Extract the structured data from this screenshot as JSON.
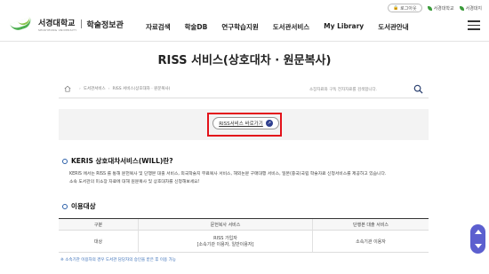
{
  "utility": {
    "login": "로그아웃",
    "link1": "서경대학교",
    "link2": "서경대지"
  },
  "logo": {
    "name": "서경대학교",
    "sub": "SEOKYEONG UNIVERSITY",
    "library": "학술정보관"
  },
  "gnb": [
    "자료검색",
    "학술DB",
    "연구학습지원",
    "도서관서비스",
    "My Library",
    "도서관안내"
  ],
  "page_title": "RISS 서비스(상호대차 · 원문복사)",
  "breadcrumb": [
    "도서관서비스",
    "RISS 서비스(상호대차 · 원문복사)"
  ],
  "search": {
    "placeholder": "소장자료와 구독 전자자료를 검색합니다."
  },
  "riss_button": "RISS서비스 바로가기",
  "keris": {
    "title": "KERIS 상호대차서비스(WILL)란?",
    "line1": "KERIS 에서는 RISS 를 통해 문헌복사 및 단행본 대출 서비스, 외국학술지 무료복사 서비스, 해외논문 구매대행 서비스, 일본(중국)국립 학술자료 신청서비스를 제공하고 있습니다.",
    "line2": "소속 도서관의 미소장 자료에 대해 원문복사 및 상호대차를 신청해보세요!"
  },
  "usage": {
    "title": "이용대상",
    "headers": [
      "구분",
      "문헌복사 서비스",
      "단행본 대출 서비스"
    ],
    "row": {
      "label": "대상",
      "service_line1": "RISS 가입자",
      "service_line2": "[소속기관 이용자, 일반이용자]",
      "loan": "소속기관 이용자"
    }
  },
  "note": "※ 소속기관 이용자의 경우 도서관 담당자의 승인을 받은 후 이용 가능"
}
